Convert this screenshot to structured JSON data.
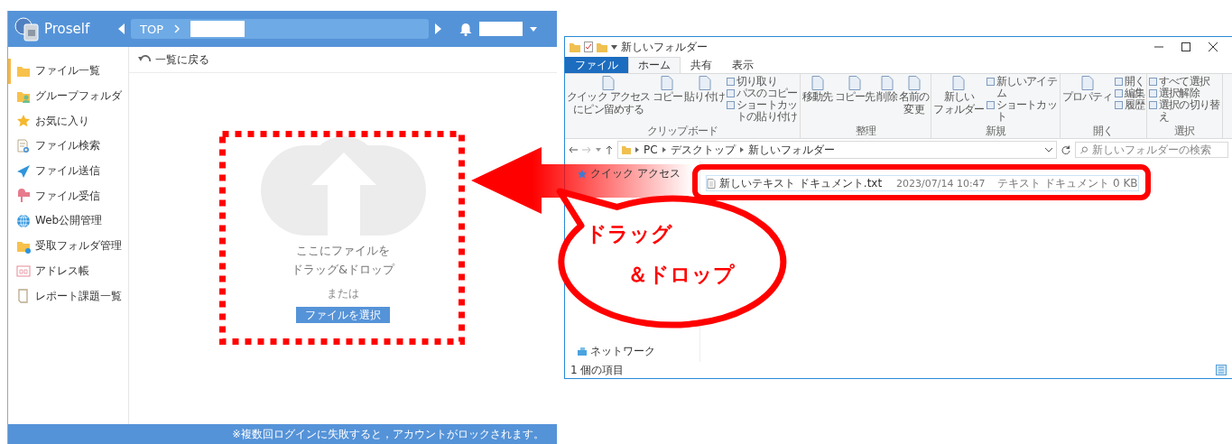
{
  "proself": {
    "logo_text": "Proself",
    "breadcrumb": [
      "TOP"
    ],
    "sidebar": {
      "items": [
        {
          "label": "ファイル一覧",
          "selected": true
        },
        {
          "label": "グループフォルダ",
          "selected": false
        },
        {
          "label": "お気に入り",
          "selected": false
        },
        {
          "label": "ファイル検索",
          "selected": false
        },
        {
          "label": "ファイル送信",
          "selected": false
        },
        {
          "label": "ファイル受信",
          "selected": false
        },
        {
          "label": "Web公開管理",
          "selected": false
        },
        {
          "label": "受取フォルダ管理",
          "selected": false
        },
        {
          "label": "アドレス帳",
          "selected": false
        },
        {
          "label": "レポート課題一覧",
          "selected": false
        }
      ]
    },
    "toolbar": {
      "back": "一覧に戻る"
    },
    "upload": {
      "message_lines": [
        "ここにファイルを",
        "ドラッグ&ドロップ"
      ],
      "or": "または",
      "button": "ファイルを選択"
    },
    "footer": "※複数回ログインに失敗すると，アカウントがロックされます。"
  },
  "explorer": {
    "title": "新しいフォルダー",
    "ribbon_tabs": [
      {
        "label": "ファイル",
        "kind": "menu",
        "selected": false
      },
      {
        "label": "ホーム",
        "kind": "tab",
        "selected": true
      },
      {
        "label": "共有",
        "kind": "tab",
        "selected": false
      },
      {
        "label": "表示",
        "kind": "tab",
        "selected": false
      }
    ],
    "ribbon_groups": [
      {
        "label": "クリップボード",
        "buttons": [
          {
            "lines": [
              "クイック アクセス",
              "にピン留めする"
            ],
            "kind": "large"
          },
          {
            "lines": [
              "コピー"
            ],
            "kind": "large"
          },
          {
            "lines": [
              "貼り付け"
            ],
            "kind": "large"
          },
          {
            "label": "切り取り",
            "kind": "small"
          },
          {
            "label": "パスのコピー",
            "kind": "small"
          },
          {
            "label": "ショートカットの貼り付け",
            "kind": "small"
          }
        ]
      },
      {
        "label": "整理",
        "buttons": [
          {
            "lines": [
              "移動先"
            ],
            "kind": "large"
          },
          {
            "lines": [
              "コピー先"
            ],
            "kind": "large"
          },
          {
            "lines": [
              "削除"
            ],
            "kind": "large"
          },
          {
            "lines": [
              "名前の",
              "変更"
            ],
            "kind": "large"
          }
        ]
      },
      {
        "label": "新規",
        "buttons": [
          {
            "lines": [
              "新しい",
              "フォルダー"
            ],
            "kind": "large"
          },
          {
            "label": "新しいアイテム",
            "kind": "small"
          },
          {
            "label": "ショートカット",
            "kind": "small"
          }
        ]
      },
      {
        "label": "開く",
        "buttons": [
          {
            "lines": [
              "プロパティ"
            ],
            "kind": "large"
          },
          {
            "label": "開く",
            "kind": "small"
          },
          {
            "label": "編集",
            "kind": "small"
          },
          {
            "label": "履歴",
            "kind": "small"
          }
        ]
      },
      {
        "label": "選択",
        "buttons": [
          {
            "label": "すべて選択",
            "kind": "small"
          },
          {
            "label": "選択解除",
            "kind": "small"
          },
          {
            "label": "選択の切り替え",
            "kind": "small"
          }
        ]
      }
    ],
    "address": [
      "PC",
      "デスクトップ",
      "新しいフォルダー"
    ],
    "search": {
      "placeholder": "新しいフォルダーの検索"
    },
    "nav": [
      {
        "label": "クイック アクセス"
      },
      {
        "label": "ネットワーク"
      }
    ],
    "files": [
      {
        "name": "新しいテキスト ドキュメント.txt",
        "modified": "2023/07/14 10:47",
        "type": "テキスト ドキュメント",
        "size": "0 KB"
      }
    ],
    "status": "1 個の項目"
  },
  "annotation": {
    "callout_lines": [
      "ドラッグ",
      "＆ドロップ"
    ]
  }
}
